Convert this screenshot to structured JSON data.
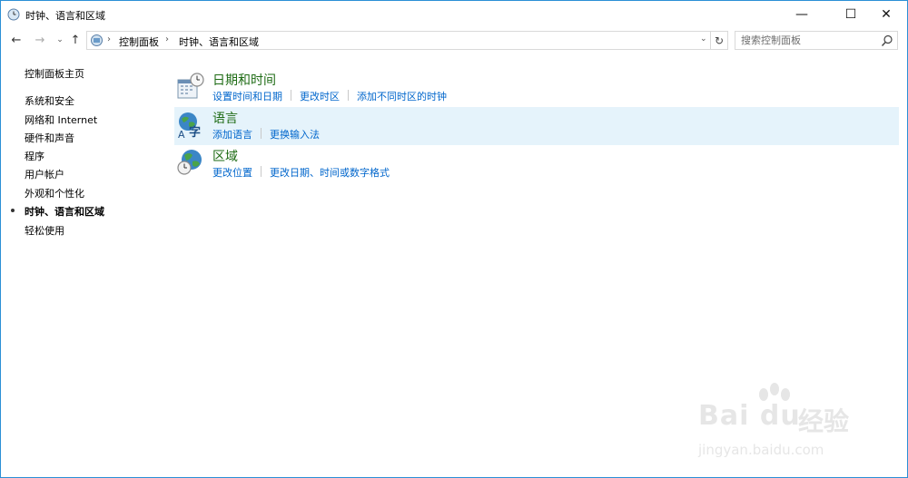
{
  "window": {
    "title": "时钟、语言和区域"
  },
  "titlebar_buttons": {
    "minimize": "—",
    "maximize": "☐",
    "close": "✕"
  },
  "nav": {
    "back": "←",
    "forward": "→",
    "recent": "⌄",
    "up": "↑",
    "refresh": "↻",
    "dropdown": "⌄"
  },
  "breadcrumb": {
    "items": [
      "控制面板",
      "时钟、语言和区域"
    ],
    "separator": "›"
  },
  "search": {
    "placeholder": "搜索控制面板"
  },
  "sidebar": {
    "home": "控制面板主页",
    "items": [
      {
        "label": "系统和安全"
      },
      {
        "label": "网络和 Internet"
      },
      {
        "label": "硬件和声音"
      },
      {
        "label": "程序"
      },
      {
        "label": "用户帐户"
      },
      {
        "label": "外观和个性化"
      },
      {
        "label": "时钟、语言和区域",
        "current": true
      },
      {
        "label": "轻松使用"
      }
    ]
  },
  "categories": [
    {
      "title": "日期和时间",
      "icon": "calendar-clock-icon",
      "links": [
        "设置时间和日期",
        "更改时区",
        "添加不同时区的时钟"
      ]
    },
    {
      "title": "语言",
      "icon": "language-globe-icon",
      "links": [
        "添加语言",
        "更换输入法"
      ],
      "highlighted": true
    },
    {
      "title": "区域",
      "icon": "region-globe-clock-icon",
      "links": [
        "更改位置",
        "更改日期、时间或数字格式"
      ]
    }
  ],
  "watermark": {
    "brand": "Bai du",
    "cn": "经验",
    "url": "jingyan.baidu.com"
  },
  "colors": {
    "accent_border": "#2b8fd6",
    "link": "#0066cc",
    "category_title": "#1e6b14",
    "hover_bg": "#e5f3fb"
  }
}
